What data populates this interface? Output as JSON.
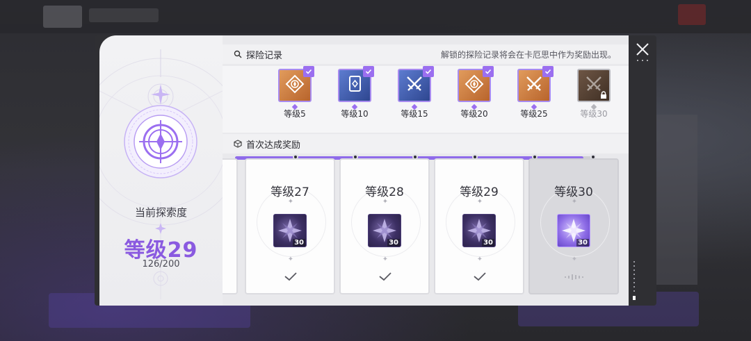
{
  "records": {
    "title": "探险记录",
    "note": "解锁的探险记录将会在卡厄思中作为奖励出现。",
    "items": [
      {
        "label": "等级5",
        "style": "orange",
        "icon": "diamond-target-icon",
        "unlocked": true
      },
      {
        "label": "等级10",
        "style": "blue",
        "icon": "card-icon",
        "unlocked": true
      },
      {
        "label": "等级15",
        "style": "blue",
        "icon": "crossed-swords-icon",
        "unlocked": true
      },
      {
        "label": "等级20",
        "style": "orange",
        "icon": "diamond-target-icon",
        "unlocked": true
      },
      {
        "label": "等级25",
        "style": "orange",
        "icon": "crossed-swords-icon",
        "unlocked": true
      },
      {
        "label": "等级30",
        "style": "brown",
        "icon": "crossed-swords-icon",
        "unlocked": false
      }
    ],
    "progress_fraction": 0.967
  },
  "current": {
    "label": "当前探索度",
    "level": "等级29",
    "progress": "126/200"
  },
  "rewards": {
    "title": "首次达成奖励",
    "items": [
      {
        "label": "等级27",
        "qty": "30",
        "claimed": true
      },
      {
        "label": "等级28",
        "qty": "30",
        "claimed": true
      },
      {
        "label": "等级29",
        "qty": "30",
        "claimed": true
      },
      {
        "label": "等级30",
        "qty": "30",
        "claimed": false
      }
    ]
  },
  "colors": {
    "accent": "#8a5ae0",
    "orange_card": "#c97a3e",
    "blue_card": "#3c59a8",
    "brown_card": "#5a4638"
  }
}
